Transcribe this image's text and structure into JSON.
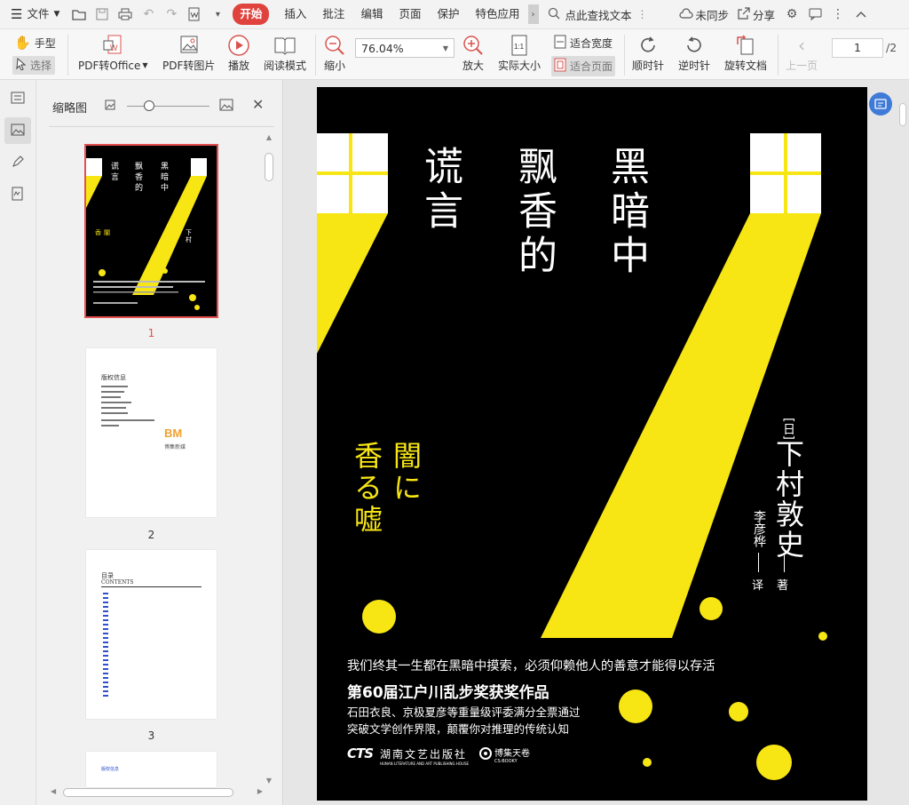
{
  "menubar": {
    "file": "文件",
    "tabs": [
      "开始",
      "插入",
      "批注",
      "编辑",
      "页面",
      "保护",
      "特色应用"
    ],
    "active_tab": "开始",
    "search_placeholder": "点此查找文本",
    "sync": "未同步",
    "share": "分享"
  },
  "toolbar": {
    "hand": "手型",
    "select": "选择",
    "pdf_to_office": "PDF转Office",
    "pdf_to_image": "PDF转图片",
    "play": "播放",
    "read_mode": "阅读模式",
    "zoom_value": "76.04%",
    "zoom_out": "缩小",
    "zoom_in": "放大",
    "actual_size": "实际大小",
    "fit_width": "适合宽度",
    "fit_page": "适合页面",
    "rotate_cw": "顺时针",
    "rotate_ccw": "逆时针",
    "rotate_doc": "旋转文档",
    "prev_page": "上一页",
    "page_current": "1",
    "page_total": "/2"
  },
  "thumbs": {
    "title": "缩略图",
    "pages": [
      {
        "num": "1"
      },
      {
        "num": "2",
        "heading": "版权信息",
        "logo": "博集新媒"
      },
      {
        "num": "3",
        "heading": "目录",
        "subheading": "CONTENTS"
      },
      {
        "num": "",
        "heading": "版权信息"
      }
    ]
  },
  "cover": {
    "title_col1": "黑暗中",
    "title_col2": "飘香的",
    "title_col3": "谎言",
    "jp_col1": "闇に",
    "jp_col2": "香る嘘",
    "author_tag": "[日]",
    "author": "下村敦史",
    "author_role": "著",
    "translator": "李彦桦",
    "translator_role": "译",
    "tagline": "我们终其一生都在黑暗中摸索，必须仰赖他人的善意才能得以存活",
    "award": "第60届江户川乱步奖获奖作品",
    "blurb1": "石田衣良、京极夏彦等重量级评委满分全票通过",
    "blurb2": "突破文学创作界限，颠覆你对推理的传统认知",
    "publisher1": "CTS",
    "publisher2": "湖南文艺出版社",
    "publisher2_en": "HUNAN LITERATURE AND ART PUBLISHING HOUSE",
    "publisher3": "博集天卷",
    "publisher3_en": "CS-BOOKY"
  },
  "colors": {
    "accent_red": "#e0433d",
    "cover_yellow": "#f7e614",
    "cover_bg": "#000000"
  }
}
